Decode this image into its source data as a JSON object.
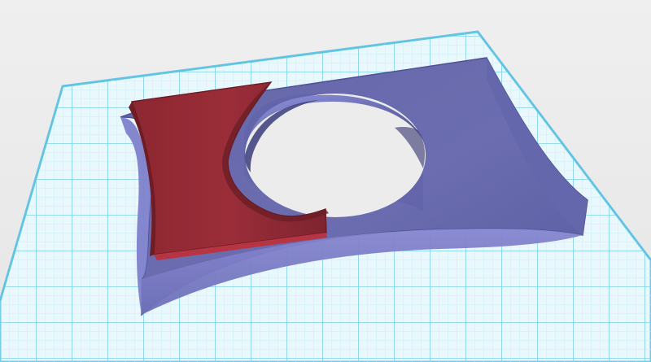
{
  "viewport": {
    "background_color": "#ececec",
    "grid_major_color": "#7fd3ea",
    "grid_minor_color": "#bfe9f4",
    "grid_edge_color": "#5dc4e3"
  },
  "model": {
    "base_plate_color": "#7f80c8",
    "base_plate_dark_color": "#5f60a4",
    "red_block_color": "#9f2f3a",
    "red_block_dark_color": "#7d222d",
    "hole_icon": "circle-hole-icon"
  }
}
